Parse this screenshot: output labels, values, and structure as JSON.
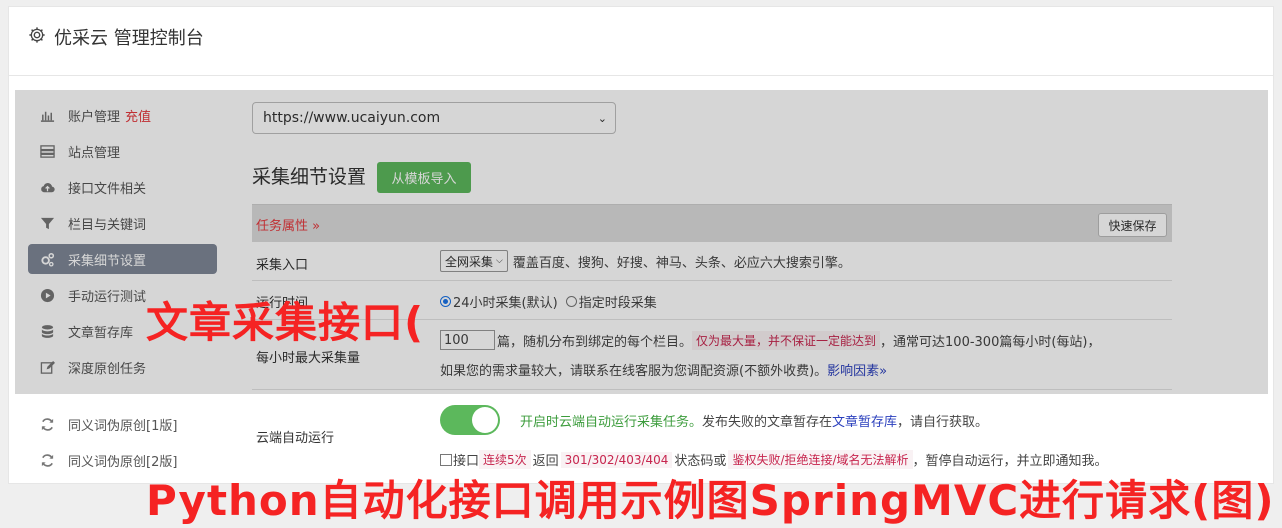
{
  "header": {
    "title": "优采云 管理控制台",
    "icon": "gear-icon"
  },
  "sidebar": {
    "items": [
      {
        "label": "账户管理",
        "extra": "充值",
        "icon": "bar-chart-icon"
      },
      {
        "label": "站点管理",
        "icon": "server-icon"
      },
      {
        "label": "接口文件相关",
        "icon": "cloud-upload-icon"
      },
      {
        "label": "栏目与关键词",
        "icon": "filter-icon"
      },
      {
        "label": "采集细节设置",
        "icon": "cogs-icon",
        "active": true
      },
      {
        "label": "手动运行测试",
        "icon": "play-circle-icon"
      },
      {
        "label": "文章暂存库",
        "icon": "database-icon"
      },
      {
        "label": "深度原创任务",
        "icon": "edit-icon"
      },
      {
        "label": "同义词伪原创[1版]",
        "icon": "refresh-icon"
      },
      {
        "label": "同义词伪原创[2版]",
        "icon": "refresh-icon"
      }
    ]
  },
  "site_select": {
    "value": "https://www.ucaiyun.com"
  },
  "section": {
    "title": "采集细节设置",
    "import_button": "从模板导入"
  },
  "table": {
    "task_attr_label": "任务属性 »",
    "quick_save": "快速保存",
    "rows": {
      "entry": {
        "label": "采集入口",
        "select_value": "全网采集",
        "desc": "覆盖百度、搜狗、好搜、神马、头条、必应六大搜索引擎。"
      },
      "run_time": {
        "label": "运行时间",
        "option1": "24小时采集(默认)",
        "option2": "指定时段采集"
      },
      "max_per_hour": {
        "label": "每小时最大采集量",
        "input_value": "100",
        "text1": "篇，随机分布到绑定的每个栏目。",
        "tag": "仅为最大量，并不保证一定能达到",
        "text2": "，通常可达100-300篇每小时(每站)，",
        "line2": "如果您的需求量较大，请联系在线客服为您调配资源(不额外收费)。",
        "link": "影响因素»"
      },
      "cloud_run": {
        "label": "云端自动运行",
        "desc_green": "开启时云端自动运行采集任务。",
        "desc1": "发布失败的文章暂存在",
        "desc_link": "文章暂存库",
        "desc2": "，请自行获取。",
        "check_label": "接口",
        "tag1": "连续5次",
        "mid1": "返回",
        "tag2": "301/302/403/404",
        "mid2": "状态码或",
        "tag3": "鉴权失败/拒绝连接/域名无法解析",
        "end": "，暂停自动运行，并立即通知我。"
      }
    }
  },
  "watermark": {
    "line1": "文章采集接口(",
    "line2": "Python自动化接口调用示例图SpringMVC进行请求(图)"
  },
  "colors": {
    "accent_green": "#5cb85c",
    "red": "#e5383d",
    "active_nav": "#7f8797"
  }
}
